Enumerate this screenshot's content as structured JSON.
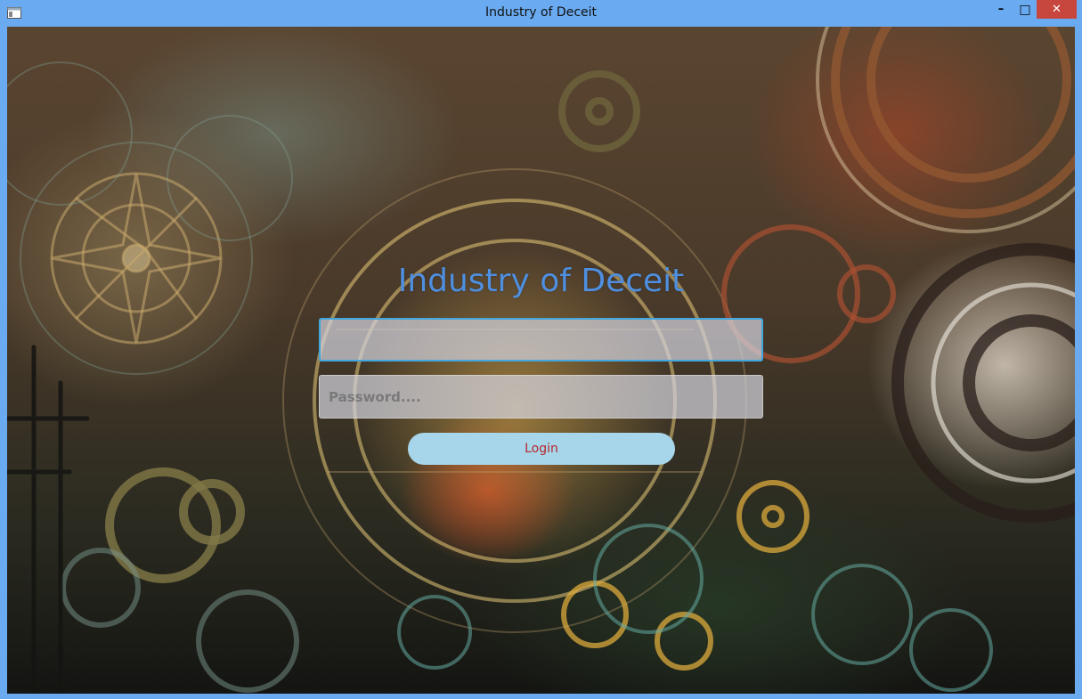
{
  "window": {
    "title": "Industry of Deceit",
    "controls": {
      "minimize": "–",
      "maximize": "□",
      "close": "✕"
    }
  },
  "login": {
    "heading": "Industry of Deceit",
    "username": {
      "value": "",
      "placeholder": ""
    },
    "password": {
      "value": "",
      "placeholder": "Password...."
    },
    "button_label": "Login"
  },
  "icons": {
    "app": "window-app-icon",
    "background": "steampunk-gears-background"
  },
  "colors": {
    "titlebar": "#6aaaf0",
    "close_button": "#c7473e",
    "heading": "#4f8fe0",
    "login_button_bg": "#a7d6ea",
    "login_button_text": "#b4272d",
    "focus_border": "#43a6dd"
  }
}
